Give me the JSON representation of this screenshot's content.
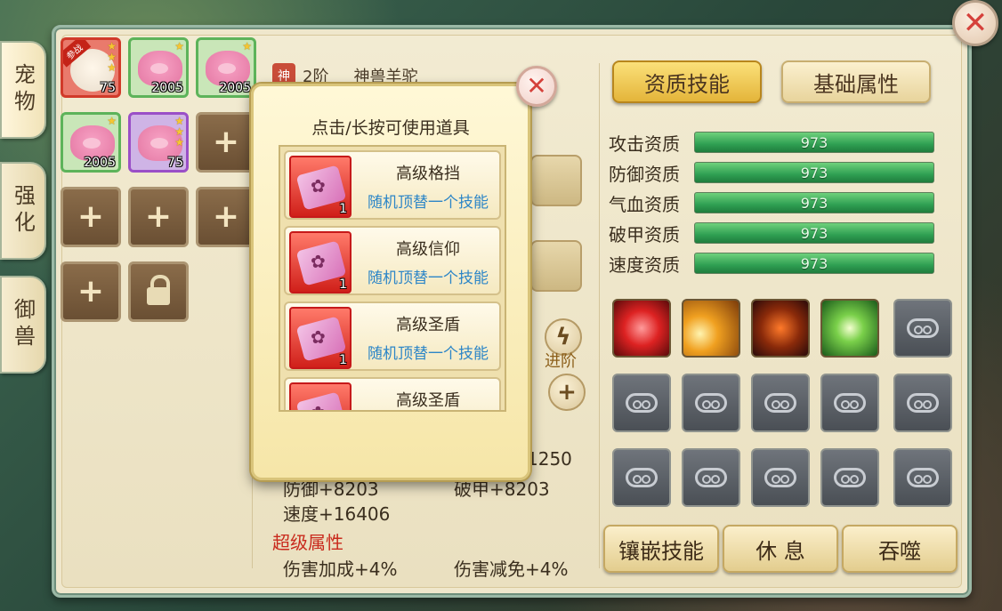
{
  "side_tabs": [
    {
      "label": "宠物",
      "active": true
    },
    {
      "label": "强化",
      "active": false
    },
    {
      "label": "御兽",
      "active": false
    }
  ],
  "pets": [
    {
      "level": "75",
      "border": "red",
      "kind": "sheep",
      "tag": "参战",
      "stars": 3
    },
    {
      "level": "2005",
      "border": "green",
      "kind": "pig",
      "stars": 1
    },
    {
      "level": "2005",
      "border": "green",
      "kind": "pig",
      "stars": 1
    },
    {
      "level": "2005",
      "border": "green",
      "kind": "pig",
      "stars": 1
    },
    {
      "level": "75",
      "border": "purple",
      "kind": "pig",
      "stars": 3
    }
  ],
  "pet_name_bar": {
    "shen_tag": "神",
    "grade": "2阶",
    "name": "神兽羊驼"
  },
  "stats": {
    "partial_value": "1250",
    "defense": "防御+8203",
    "armor_break": "破甲+8203",
    "speed": "速度+16406"
  },
  "super_attributes": {
    "title": "超级属性",
    "damage_bonus": "伤害加成+4%",
    "damage_reduction": "伤害减免+4%"
  },
  "advance_label": "进阶",
  "right_tabs": {
    "aptitude_skills": "资质技能",
    "basic_attributes": "基础属性"
  },
  "aptitudes": [
    {
      "label": "攻击资质",
      "value": "973",
      "fraction": 1.0
    },
    {
      "label": "防御资质",
      "value": "973",
      "fraction": 1.0
    },
    {
      "label": "气血资质",
      "value": "973",
      "fraction": 1.0
    },
    {
      "label": "破甲资质",
      "value": "973",
      "fraction": 1.0
    },
    {
      "label": "速度资质",
      "value": "973",
      "fraction": 1.0
    }
  ],
  "bottom_buttons": {
    "inlay_skill": "镶嵌技能",
    "rest": "休 息",
    "devour": "吞噬"
  },
  "popup": {
    "title": "点击/长按可使用道具",
    "items": [
      {
        "name": "高级格挡",
        "desc": "随机顶替一个技能",
        "count": "1"
      },
      {
        "name": "高级信仰",
        "desc": "随机顶替一个技能",
        "count": "1"
      },
      {
        "name": "高级圣盾",
        "desc": "随机顶替一个技能",
        "count": "1"
      },
      {
        "name": "高级圣盾",
        "desc": "",
        "count": ""
      }
    ]
  },
  "colors": {
    "accent_gold": "#e4b53a",
    "aptitude_bar": "#2f9f52",
    "item_desc_blue": "#2d86c7",
    "super_attr_red": "#c92a1d"
  }
}
